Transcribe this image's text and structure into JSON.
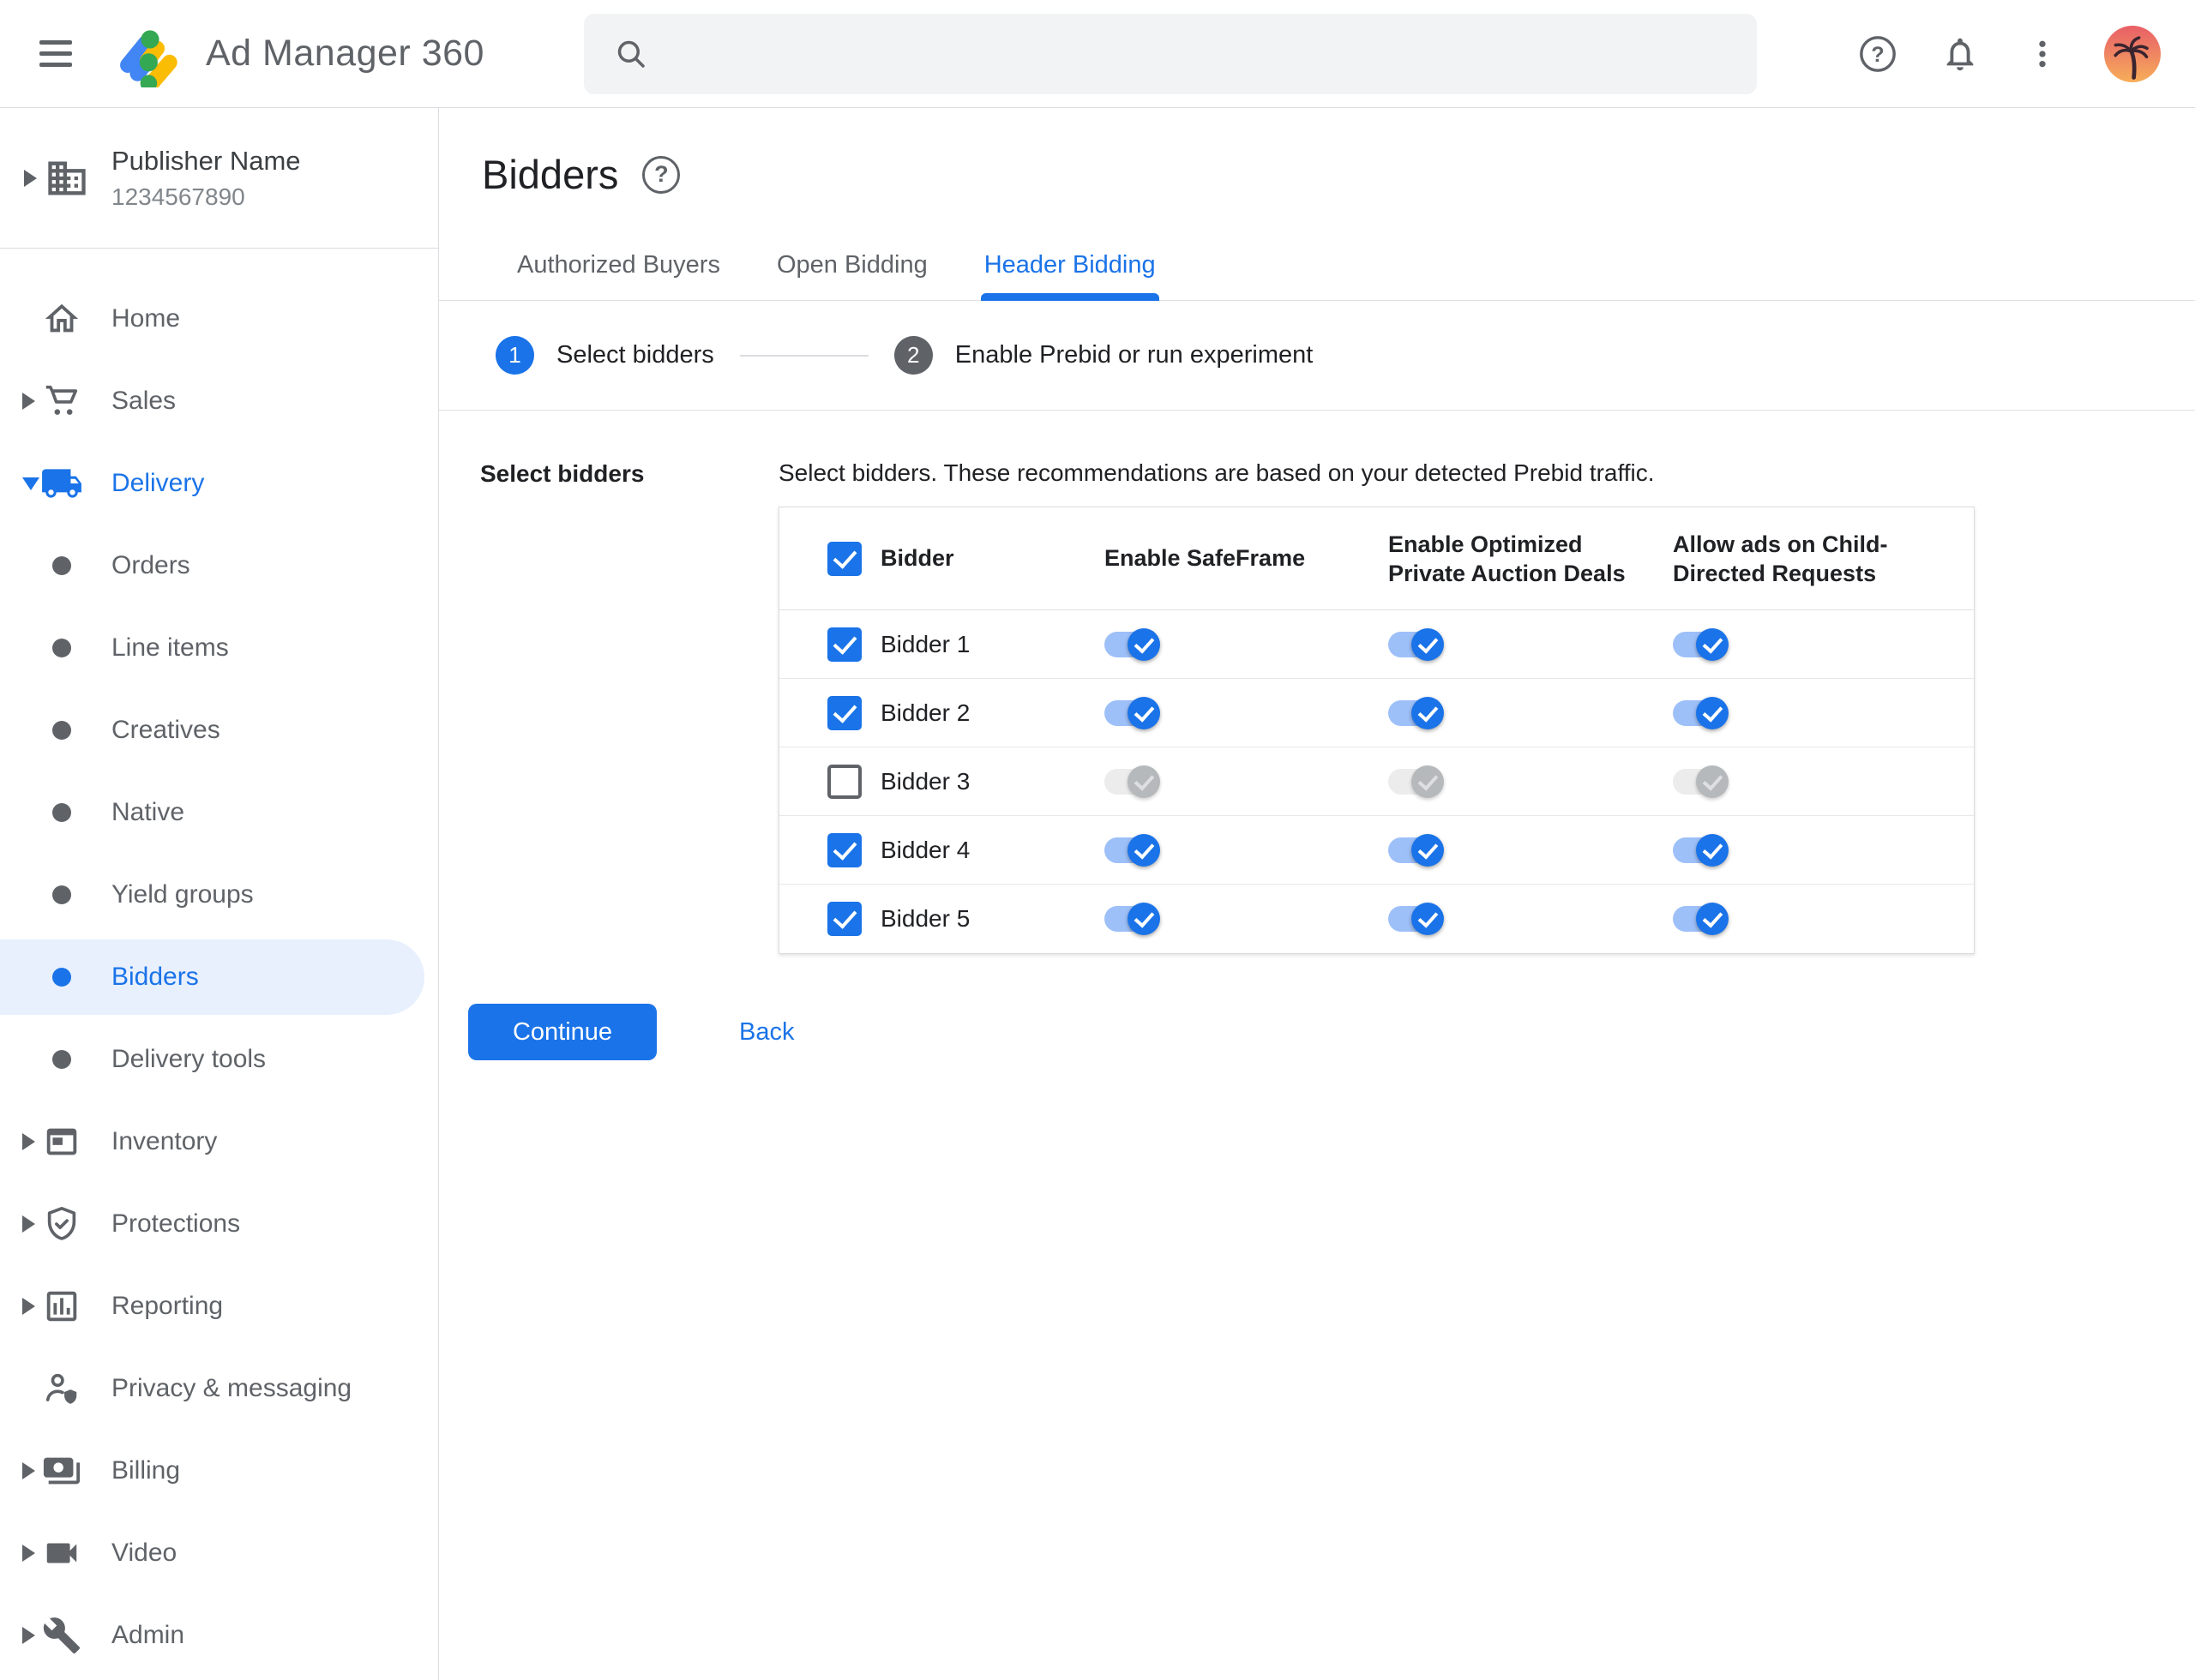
{
  "topbar": {
    "app_title": "Ad Manager 360",
    "search": {
      "placeholder": "",
      "value": ""
    },
    "icons": [
      "menu-icon",
      "ad-manager-logo",
      "search-icon",
      "help-icon",
      "notifications-icon",
      "overflow-menu-icon",
      "account-avatar-palm-tree"
    ]
  },
  "publisher": {
    "name": "Publisher Name",
    "id": "1234567890",
    "icon": "organization-building-icon"
  },
  "sidebar": {
    "items": [
      {
        "label": "Home",
        "icon": "home"
      },
      {
        "label": "Sales",
        "icon": "shopping-cart",
        "expandable": true
      },
      {
        "label": "Delivery",
        "icon": "delivery-truck",
        "expanded": true,
        "highlighted": true
      },
      {
        "label": "Orders",
        "icon": "bullet"
      },
      {
        "label": "Line items",
        "icon": "bullet"
      },
      {
        "label": "Creatives",
        "icon": "bullet"
      },
      {
        "label": "Native",
        "icon": "bullet"
      },
      {
        "label": "Yield groups",
        "icon": "bullet"
      },
      {
        "label": "Bidders",
        "icon": "bullet",
        "selected": true
      },
      {
        "label": "Delivery tools",
        "icon": "bullet"
      },
      {
        "label": "Inventory",
        "icon": "inventory-frame",
        "expandable": true
      },
      {
        "label": "Protections",
        "icon": "shield-check",
        "expandable": true
      },
      {
        "label": "Reporting",
        "icon": "bar-chart",
        "expandable": true
      },
      {
        "label": "Privacy & messaging",
        "icon": "person-shield"
      },
      {
        "label": "Billing",
        "icon": "payments",
        "expandable": true
      },
      {
        "label": "Video",
        "icon": "video-camera",
        "expandable": true
      },
      {
        "label": "Admin",
        "icon": "wrench",
        "expandable": true
      }
    ]
  },
  "page": {
    "title": "Bidders",
    "tabs": [
      {
        "label": "Authorized Buyers",
        "active": false
      },
      {
        "label": "Open Bidding",
        "active": false
      },
      {
        "label": "Header Bidding",
        "active": true
      }
    ],
    "stepper": [
      {
        "num": "1",
        "label": "Select bidders",
        "active": true
      },
      {
        "num": "2",
        "label": "Enable Prebid or run experiment",
        "active": false
      }
    ],
    "section_label": "Select bidders",
    "description": "Select bidders. These recommendations are based on your detected Prebid traffic.",
    "table": {
      "headers": [
        "Bidder",
        "Enable SafeFrame",
        "Enable Optimized Private Auction Deals",
        "Allow ads on Child-Directed Requests"
      ],
      "header_checkbox_checked": true,
      "rows": [
        {
          "name": "Bidder 1",
          "selected": true,
          "enable_safeframe": true,
          "enable_optimized_private_auction_deals": true,
          "allow_ads_on_child_directed_requests": true
        },
        {
          "name": "Bidder 2",
          "selected": true,
          "enable_safeframe": true,
          "enable_optimized_private_auction_deals": true,
          "allow_ads_on_child_directed_requests": true
        },
        {
          "name": "Bidder 3",
          "selected": false,
          "enable_safeframe": false,
          "enable_optimized_private_auction_deals": false,
          "allow_ads_on_child_directed_requests": false
        },
        {
          "name": "Bidder 4",
          "selected": true,
          "enable_safeframe": true,
          "enable_optimized_private_auction_deals": true,
          "allow_ads_on_child_directed_requests": true
        },
        {
          "name": "Bidder 5",
          "selected": true,
          "enable_safeframe": true,
          "enable_optimized_private_auction_deals": true,
          "allow_ads_on_child_directed_requests": true
        }
      ]
    },
    "continue_label": "Continue",
    "back_label": "Back"
  },
  "colors": {
    "accent": "#1a73e8",
    "selected_nav_bg": "#e8f0fe",
    "toggle_track_on": "#9ec0f9",
    "toggle_thumb_on": "#1a73e8",
    "toggle_track_disabled": "#ececec",
    "toggle_thumb_disabled": "#b6b9bc",
    "border": "#dadce0",
    "icon_gray": "#5f6368"
  }
}
